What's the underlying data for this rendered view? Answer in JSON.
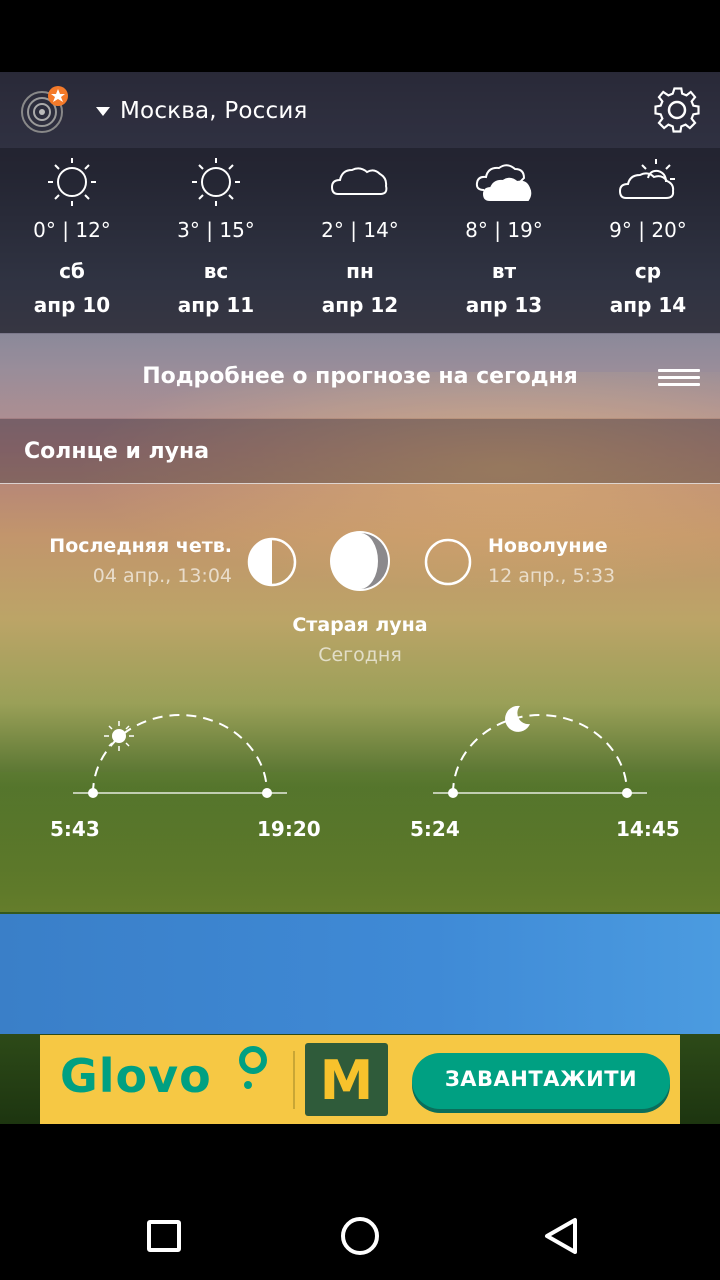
{
  "header": {
    "location": "Москва, Россия",
    "logo_icon": "radar-star-logo",
    "settings_icon": "gear-icon"
  },
  "forecast": [
    {
      "icon": "sun",
      "temp": "0° | 12°",
      "dow": "сб",
      "date": "апр 10"
    },
    {
      "icon": "sun",
      "temp": "3° | 15°",
      "dow": "вс",
      "date": "апр 11"
    },
    {
      "icon": "cloud",
      "temp": "2° | 14°",
      "dow": "пн",
      "date": "апр 12"
    },
    {
      "icon": "cloudy",
      "temp": "8° | 19°",
      "dow": "вт",
      "date": "апр 13"
    },
    {
      "icon": "partly-cloudy",
      "temp": "9° | 20°",
      "dow": "ср",
      "date": "апр 14"
    }
  ],
  "details": {
    "label": "Подробнее о прогнозе на сегодня"
  },
  "sun_moon": {
    "title": "Солнце и луна",
    "prev_phase": {
      "name": "Последняя четв.",
      "date": "04 апр., 13:04"
    },
    "current_phase": {
      "name": "Старая луна",
      "date": "Сегодня"
    },
    "next_phase": {
      "name": "Новолуние",
      "date": "12 апр., 5:33"
    },
    "sunrise": "5:43",
    "sunset": "19:20",
    "moonrise": "5:24",
    "moonset": "14:45"
  },
  "ad": {
    "brand": "Glovo",
    "partner_logo": "M",
    "cta": "ЗАВАНТАЖИТИ",
    "colors": {
      "background": "#f6c844",
      "brand": "#00a082"
    }
  },
  "navbar": {
    "buttons": [
      "recents-icon",
      "home-icon",
      "back-icon"
    ]
  }
}
